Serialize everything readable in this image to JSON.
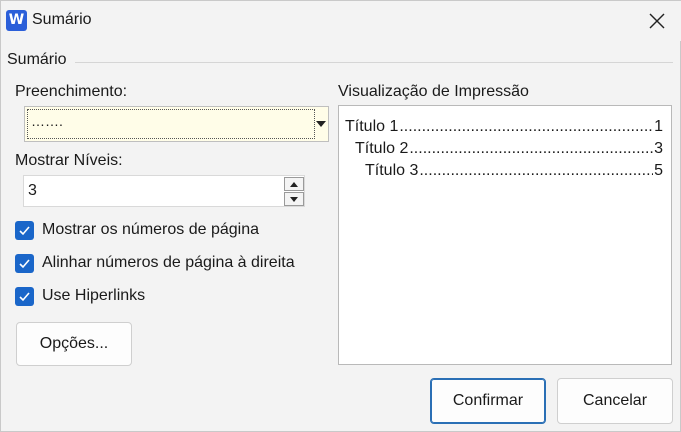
{
  "window": {
    "title": "Sumário",
    "app_icon_letter": "W"
  },
  "section": {
    "label": "Sumário"
  },
  "fill": {
    "label": "Preenchimento:",
    "value": "……."
  },
  "levels": {
    "label": "Mostrar Níveis:",
    "value": "3"
  },
  "checkboxes": [
    {
      "label": "Mostrar os números de página",
      "checked": true
    },
    {
      "label": "Alinhar números de página à direita",
      "checked": true
    },
    {
      "label": "Use Hiperlinks",
      "checked": true
    }
  ],
  "options_button": "Opções...",
  "preview": {
    "label": "Visualização de Impressão",
    "entries": [
      {
        "title": "Título 1",
        "page": "1"
      },
      {
        "title": "Título 2",
        "page": "3"
      },
      {
        "title": "Título 3",
        "page": "5"
      }
    ]
  },
  "buttons": {
    "confirm": "Confirmar",
    "cancel": "Cancelar"
  },
  "colors": {
    "accent": "#1a66c9",
    "app_icon": "#2b5fd9",
    "fill_bg": "#fffde8"
  },
  "icons": {
    "close": "close-icon",
    "app": "word-app-icon",
    "check": "check-icon"
  }
}
